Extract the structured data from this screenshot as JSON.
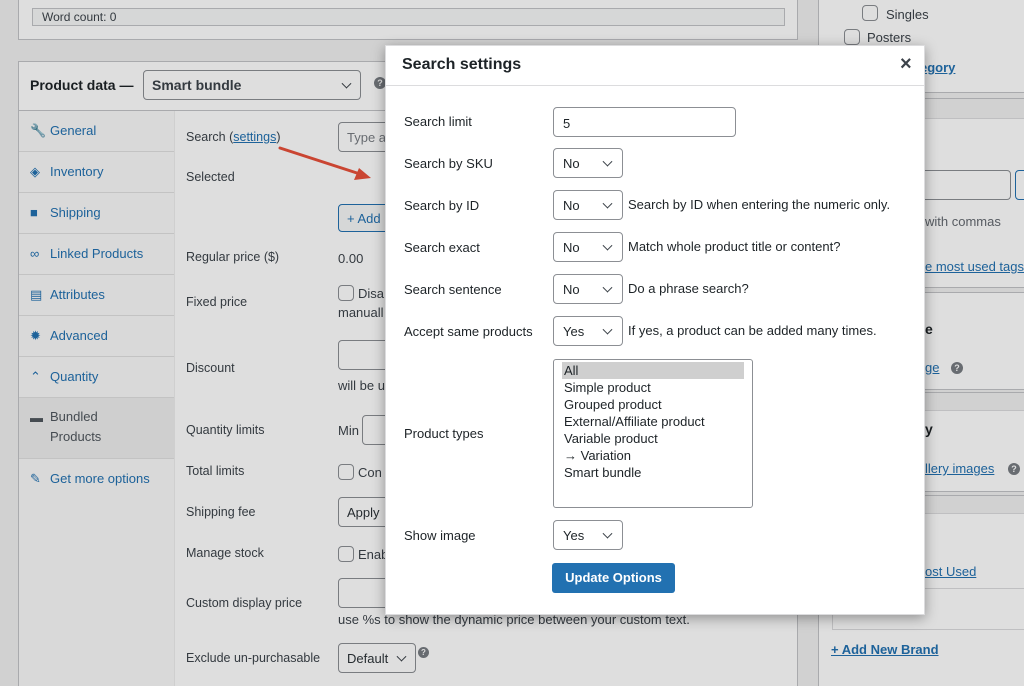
{
  "editor": {
    "word_count": "Word count: 0"
  },
  "product_data": {
    "title": "Product data —",
    "type_select": "Smart bundle",
    "tabs": [
      {
        "label": "General",
        "icon": "wrench-icon"
      },
      {
        "label": "Inventory",
        "icon": "tag-icon"
      },
      {
        "label": "Shipping",
        "icon": "truck-icon"
      },
      {
        "label": "Linked Products",
        "icon": "link-icon"
      },
      {
        "label": "Attributes",
        "icon": "list-icon"
      },
      {
        "label": "Advanced",
        "icon": "gear-icon"
      },
      {
        "label": "Quantity",
        "icon": "quantity-icon"
      },
      {
        "label": "Bundled Products",
        "icon": "archive-icon"
      },
      {
        "label": "Get more options",
        "icon": "plugin-icon"
      }
    ],
    "fields": {
      "search_prefix": "Search (",
      "search_link": "settings",
      "search_suffix": ")",
      "search_placeholder": "Type a",
      "selected": "Selected",
      "add_button": "+ Add",
      "regular_price": "Regular price ($)",
      "regular_price_value": "0.00",
      "fixed_price": "Fixed price",
      "fixed_price_text": "Disa",
      "fixed_price_text2": "manuall",
      "discount": "Discount",
      "discount_hint": "will be u",
      "quantity_limits": "Quantity limits",
      "quantity_min": "Min",
      "total_limits": "Total limits",
      "total_limits_text": "Con",
      "shipping_fee": "Shipping fee",
      "shipping_fee_value": "Apply",
      "manage_stock": "Manage stock",
      "manage_stock_text": "Enab",
      "custom_display_price": "Custom display price",
      "custom_display_hint": "use %s to show the dynamic price between your custom text.",
      "exclude_unpurchasable": "Exclude un-purchasable",
      "exclude_value": "Default"
    }
  },
  "sidebar": {
    "cat_singles": "Singles",
    "cat_posters": "Posters",
    "add_category": "egory",
    "tags_hint": "with commas",
    "tags_link": "e most used tags",
    "image_title": "e",
    "image_link": "ge",
    "gallery_title": "y",
    "gallery_link": "llery images",
    "brands_link": "ost Used",
    "add_brand": "+ Add New Brand"
  },
  "modal": {
    "title": "Search settings",
    "rows": {
      "search_limit": {
        "label": "Search limit",
        "value": "5"
      },
      "search_sku": {
        "label": "Search by SKU",
        "value": "No"
      },
      "search_id": {
        "label": "Search by ID",
        "value": "No",
        "hint": "Search by ID when entering the numeric only."
      },
      "search_exact": {
        "label": "Search exact",
        "value": "No",
        "hint": "Match whole product title or content?"
      },
      "search_sentence": {
        "label": "Search sentence",
        "value": "No",
        "hint": "Do a phrase search?"
      },
      "accept_same": {
        "label": "Accept same products",
        "value": "Yes",
        "hint": "If yes, a product can be added many times."
      },
      "product_types": {
        "label": "Product types",
        "options": [
          "All",
          "Simple product",
          "Grouped product",
          "External/Affiliate product",
          "Variable product",
          "→ Variation",
          "Smart bundle"
        ]
      },
      "show_image": {
        "label": "Show image",
        "value": "Yes"
      }
    },
    "update_button": "Update Options"
  },
  "colors": {
    "accent": "#2271b1",
    "arrow": "#e8503a"
  }
}
